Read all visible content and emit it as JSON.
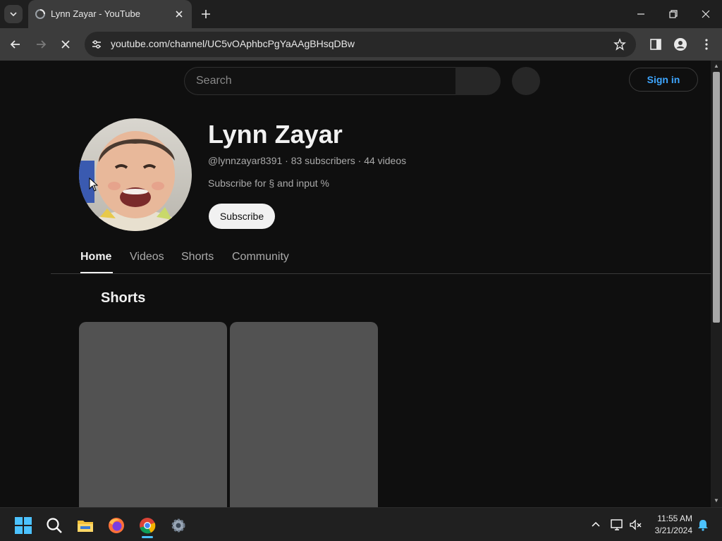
{
  "browser": {
    "tab_title": "Lynn Zayar - YouTube",
    "url": "youtube.com/channel/UC5vOAphbcPgYaAAgBHsqDBw"
  },
  "youtube": {
    "search_placeholder": "Search",
    "sign_in_label": "Sign in",
    "channel": {
      "name": "Lynn Zayar",
      "meta": "@lynnzayar8391 · 83 subscribers · 44 videos",
      "description": "Subscribe for § and input %",
      "subscribe_label": "Subscribe"
    },
    "tabs": [
      {
        "label": "Home",
        "active": true
      },
      {
        "label": "Videos",
        "active": false
      },
      {
        "label": "Shorts",
        "active": false
      },
      {
        "label": "Community",
        "active": false
      }
    ],
    "section_title": "Shorts"
  },
  "taskbar": {
    "time": "11:55 AM",
    "date": "3/21/2024"
  },
  "colors": {
    "accent_link": "#3ea6ff",
    "page_bg": "#0f0f0f",
    "chrome_bg": "#3c3c3c"
  }
}
